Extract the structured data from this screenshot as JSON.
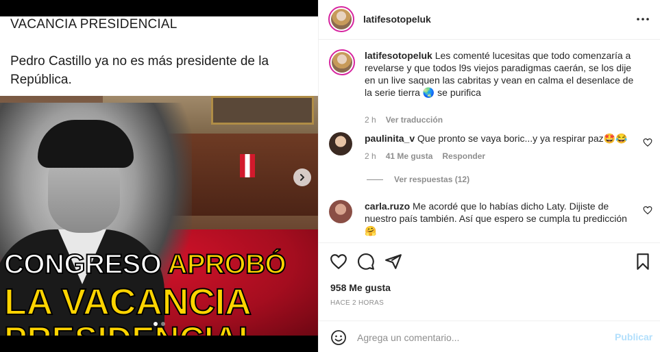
{
  "post": {
    "heading": "VACANCIA PRESIDENCIAL",
    "body": "Pedro Castillo ya no es más presidente de la República.",
    "headline_word1": "CONGRESO",
    "headline_word2": "APROBÓ",
    "headline_line2": "LA VACANCIA",
    "headline_line3": "PRESIDENCIAL",
    "carousel_total": 2,
    "carousel_active": 1
  },
  "header": {
    "username": "latifesotopeluk",
    "more_icon": "more-horizontal-icon"
  },
  "caption": {
    "username": "latifesotopeluk",
    "text": "Les comenté lucesitas que todo comenzaría a revelarse y que todos l9s viejos paradigmas caerán, se los dije en un live saquen las cabritas y vean en calma el desenlace de la serie tierra",
    "emoji": "🌏",
    "text_end": " se purifica",
    "time": "2 h",
    "translate": "Ver traducción"
  },
  "comments": [
    {
      "username": "paulinita_v",
      "text": "Que pronto se vaya boric...y ya respirar paz",
      "emoji": "🤩😂",
      "time": "2 h",
      "likes": "41 Me gusta",
      "reply": "Responder",
      "replies": "Ver respuestas (12)"
    },
    {
      "username": "carla.ruzo",
      "text": "Me acordé que lo habías dicho Laty. Dijiste de nuestro país también. Así que espero se cumpla tu predicción",
      "emoji": "🤗"
    }
  ],
  "actions": {
    "like_icon": "heart-icon",
    "comment_icon": "comment-icon",
    "share_icon": "paper-plane-icon",
    "save_icon": "bookmark-icon",
    "likes": "958 Me gusta",
    "time_ago": "HACE 2 HORAS"
  },
  "add_comment": {
    "placeholder": "Agrega un comentario...",
    "publish": "Publicar"
  },
  "colors": {
    "accent_disabled": "#b2dffc",
    "muted": "#8e8e8e",
    "text": "#262626",
    "headline_yellow": "#ffd400"
  }
}
